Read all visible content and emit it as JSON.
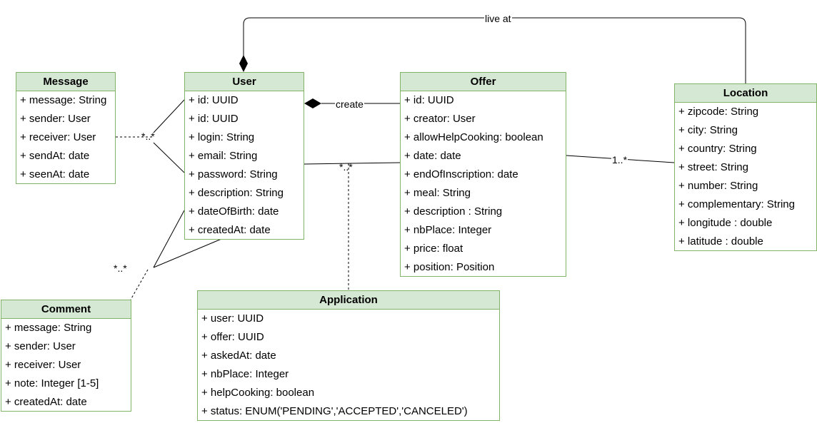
{
  "classes": {
    "message": {
      "name": "Message",
      "attributes": [
        "+ message: String",
        "+ sender: User",
        "+ receiver: User",
        "+ sendAt: date",
        "+ seenAt: date"
      ]
    },
    "user": {
      "name": "User",
      "attributes": [
        "+ id: UUID",
        "+ id: UUID",
        "+ login: String",
        "+ email: String",
        "+ password: String",
        "+ description: String",
        "+ dateOfBirth: date",
        "+ createdAt: date"
      ]
    },
    "offer": {
      "name": "Offer",
      "attributes": [
        "+ id: UUID",
        "+ creator: User",
        "+ allowHelpCooking: boolean",
        "+ date: date",
        "+ endOfInscription: date",
        "+ meal: String",
        "+ description : String",
        "+ nbPlace: Integer",
        "+ price: float",
        "+ position: Position"
      ]
    },
    "location": {
      "name": "Location",
      "attributes": [
        "+ zipcode: String",
        "+ city: String",
        "+ country: String",
        "+ street: String",
        "+ number: String",
        "+ complementary: String",
        "+ longitude : double",
        "+ latitude : double"
      ]
    },
    "comment": {
      "name": "Comment",
      "attributes": [
        "+ message: String",
        "+ sender: User",
        "+ receiver: User",
        "+ note: Integer [1-5]",
        "+ createdAt: date"
      ]
    },
    "application": {
      "name": "Application",
      "attributes": [
        "+ user: UUID",
        "+ offer: UUID",
        "+ askedAt: date",
        "+ nbPlace: Integer",
        "+ helpCooking: boolean",
        "+ status: ENUM('PENDING','ACCEPTED','CANCELED')"
      ]
    }
  },
  "relations": {
    "live_at": "live at",
    "create": "create",
    "message_multiplicity": "*..*",
    "comment_multiplicity": "*..*",
    "application_multiplicity": "*..*",
    "location_multiplicity": "1..*"
  },
  "colors": {
    "header_fill": "#d5e8d4",
    "border": "#82b366",
    "line": "#000000"
  }
}
